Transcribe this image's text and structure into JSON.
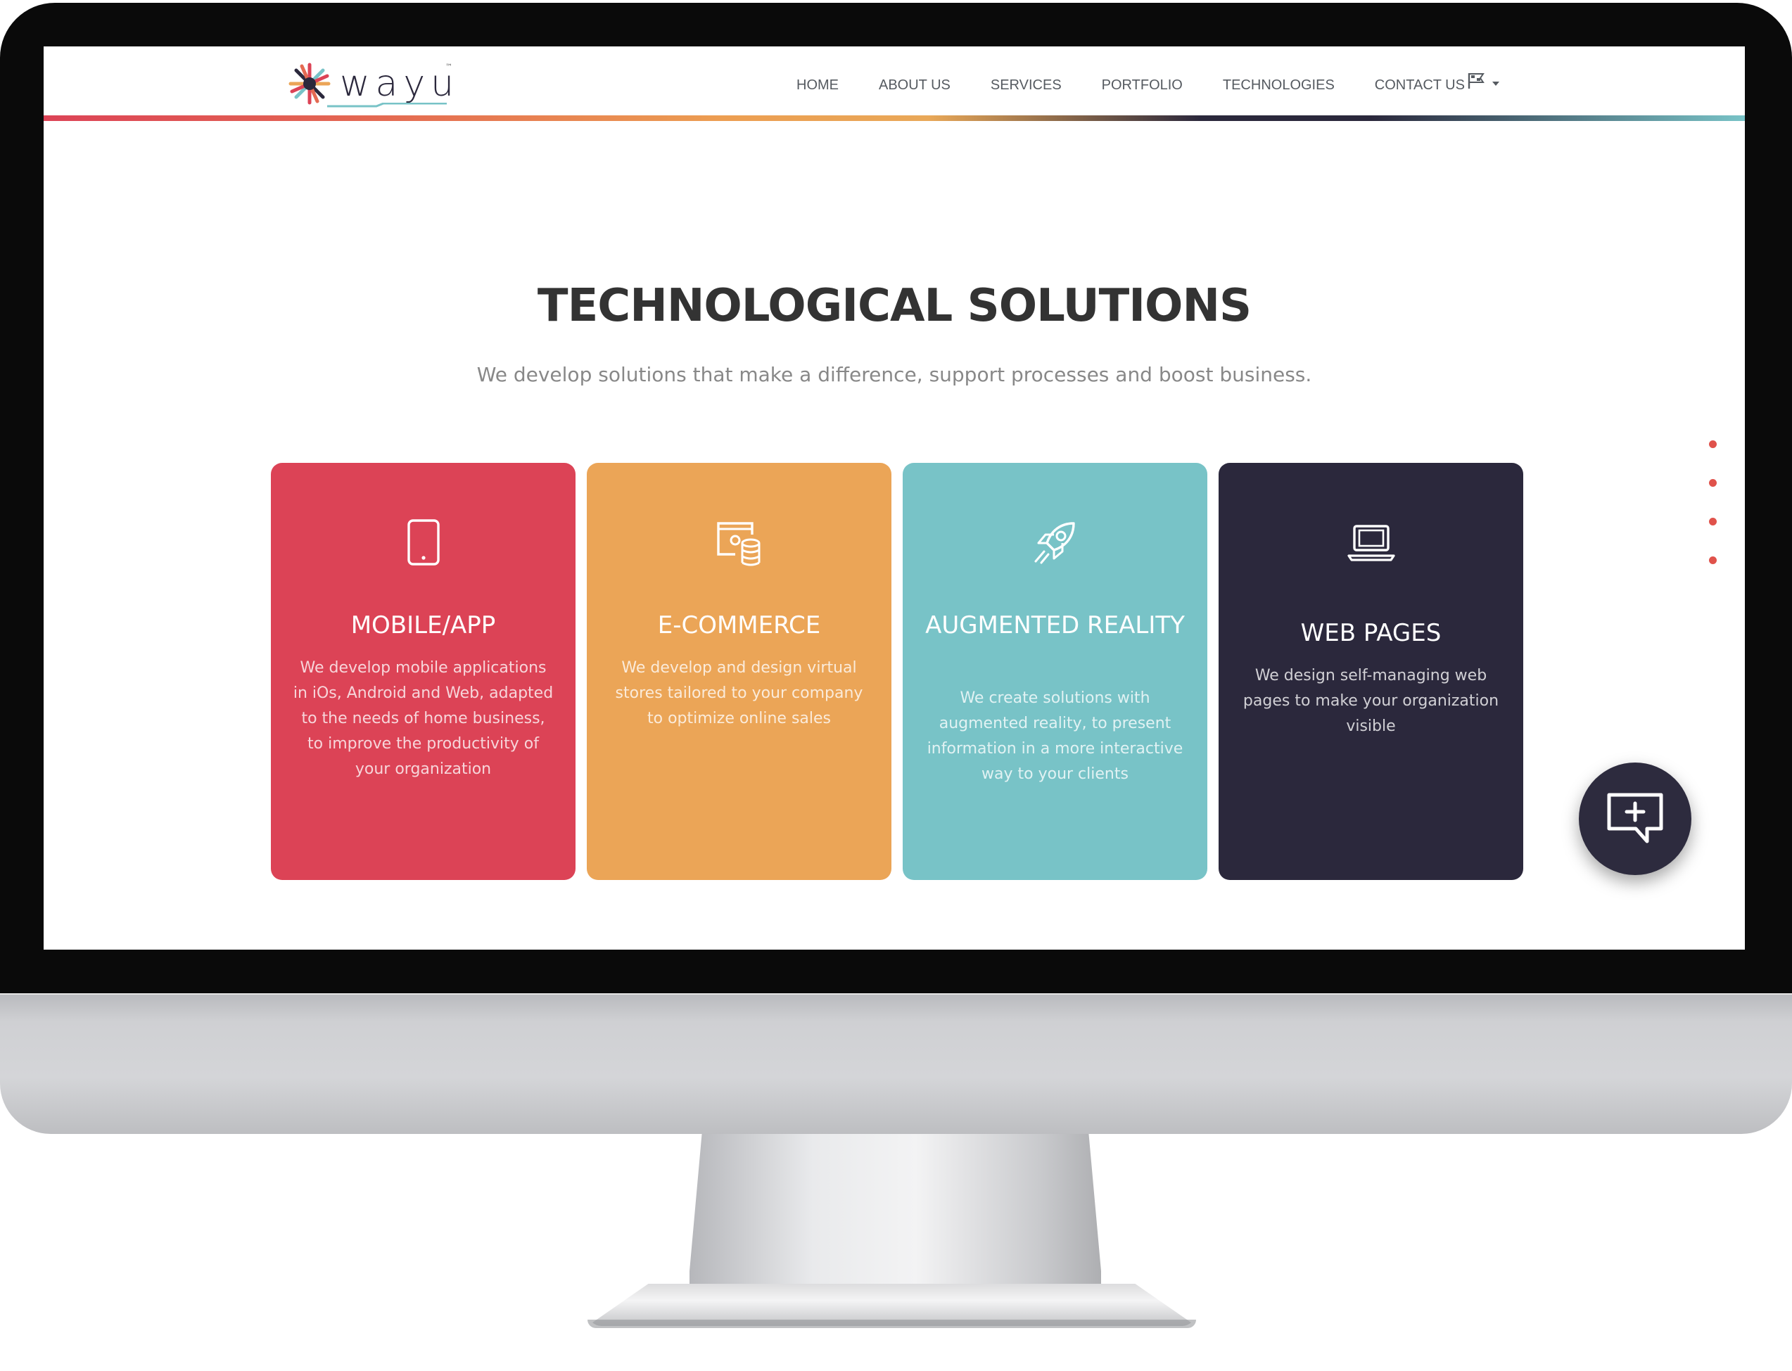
{
  "brand": {
    "logo_text": "wayu",
    "trademark": "™"
  },
  "nav": {
    "items": [
      "HOME",
      "ABOUT US",
      "SERVICES",
      "PORTFOLIO",
      "TECHNOLOGIES",
      "CONTACT US"
    ],
    "language_icon": "flag-icon"
  },
  "hero": {
    "title": "TECHNOLOGICAL SOLUTIONS",
    "subtitle": "We develop solutions that make a difference, support processes and boost business."
  },
  "cards": [
    {
      "icon": "tablet-icon",
      "title": "MOBILE/APP",
      "description": "We develop mobile applications in iOs, Android and Web, adapted to the needs of home business, to improve the productivity of your organization",
      "color": "#dc4356"
    },
    {
      "icon": "store-database-icon",
      "title": "E-COMMERCE",
      "description": "We develop and design virtual stores tailored to your company to optimize online sales",
      "color": "#eba557"
    },
    {
      "icon": "rocket-icon",
      "title": "AUGMENTED REALITY",
      "description": "We create solutions with augmented reality, to present information in a more interactive way to your clients",
      "color": "#78c3c7"
    },
    {
      "icon": "laptop-icon",
      "title": "WEB PAGES",
      "description": "We design self-managing web pages to make your organization visible",
      "color": "#2b283c"
    }
  ],
  "section_nav_dots": 4,
  "chat_button": {
    "icon": "chat-add-icon"
  },
  "colors": {
    "accent_red": "#dc4356",
    "accent_orange": "#eba557",
    "accent_teal": "#78c3c7",
    "accent_navy": "#2b283c"
  }
}
